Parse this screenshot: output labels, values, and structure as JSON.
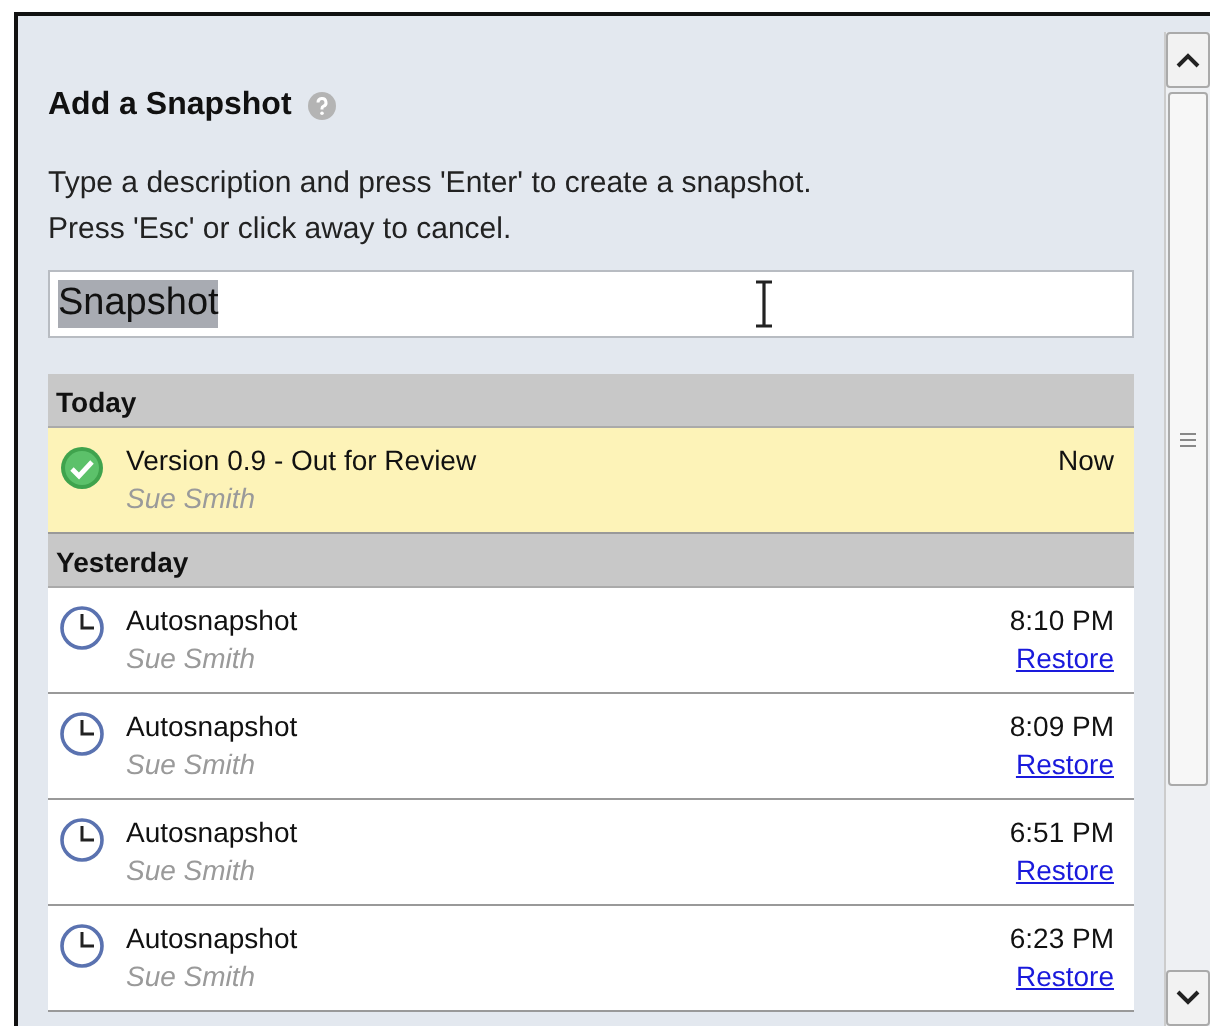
{
  "panel": {
    "title": "Add a Snapshot",
    "description": "Type a description and press 'Enter' to create a snapshot.\nPress 'Esc' or click away to cancel.",
    "field": {
      "value": "Snapshot",
      "value_selected": true
    }
  },
  "groups": [
    {
      "label": "Today",
      "items": [
        {
          "kind": "milestone",
          "title": "Version 0.9 - Out for Review",
          "author": "Sue Smith",
          "time": "Now",
          "selected": true
        }
      ]
    },
    {
      "label": "Yesterday",
      "items": [
        {
          "kind": "auto",
          "title": "Autosnapshot",
          "author": "Sue Smith",
          "time": "8:10 PM",
          "restore": "Restore",
          "selected": false
        },
        {
          "kind": "auto",
          "title": "Autosnapshot",
          "author": "Sue Smith",
          "time": "8:09 PM",
          "restore": "Restore",
          "selected": false
        },
        {
          "kind": "auto",
          "title": "Autosnapshot",
          "author": "Sue Smith",
          "time": "6:51 PM",
          "restore": "Restore",
          "selected": false
        },
        {
          "kind": "auto",
          "title": "Autosnapshot",
          "author": "Sue Smith",
          "time": "6:23 PM",
          "restore": "Restore",
          "selected": false
        }
      ]
    }
  ]
}
